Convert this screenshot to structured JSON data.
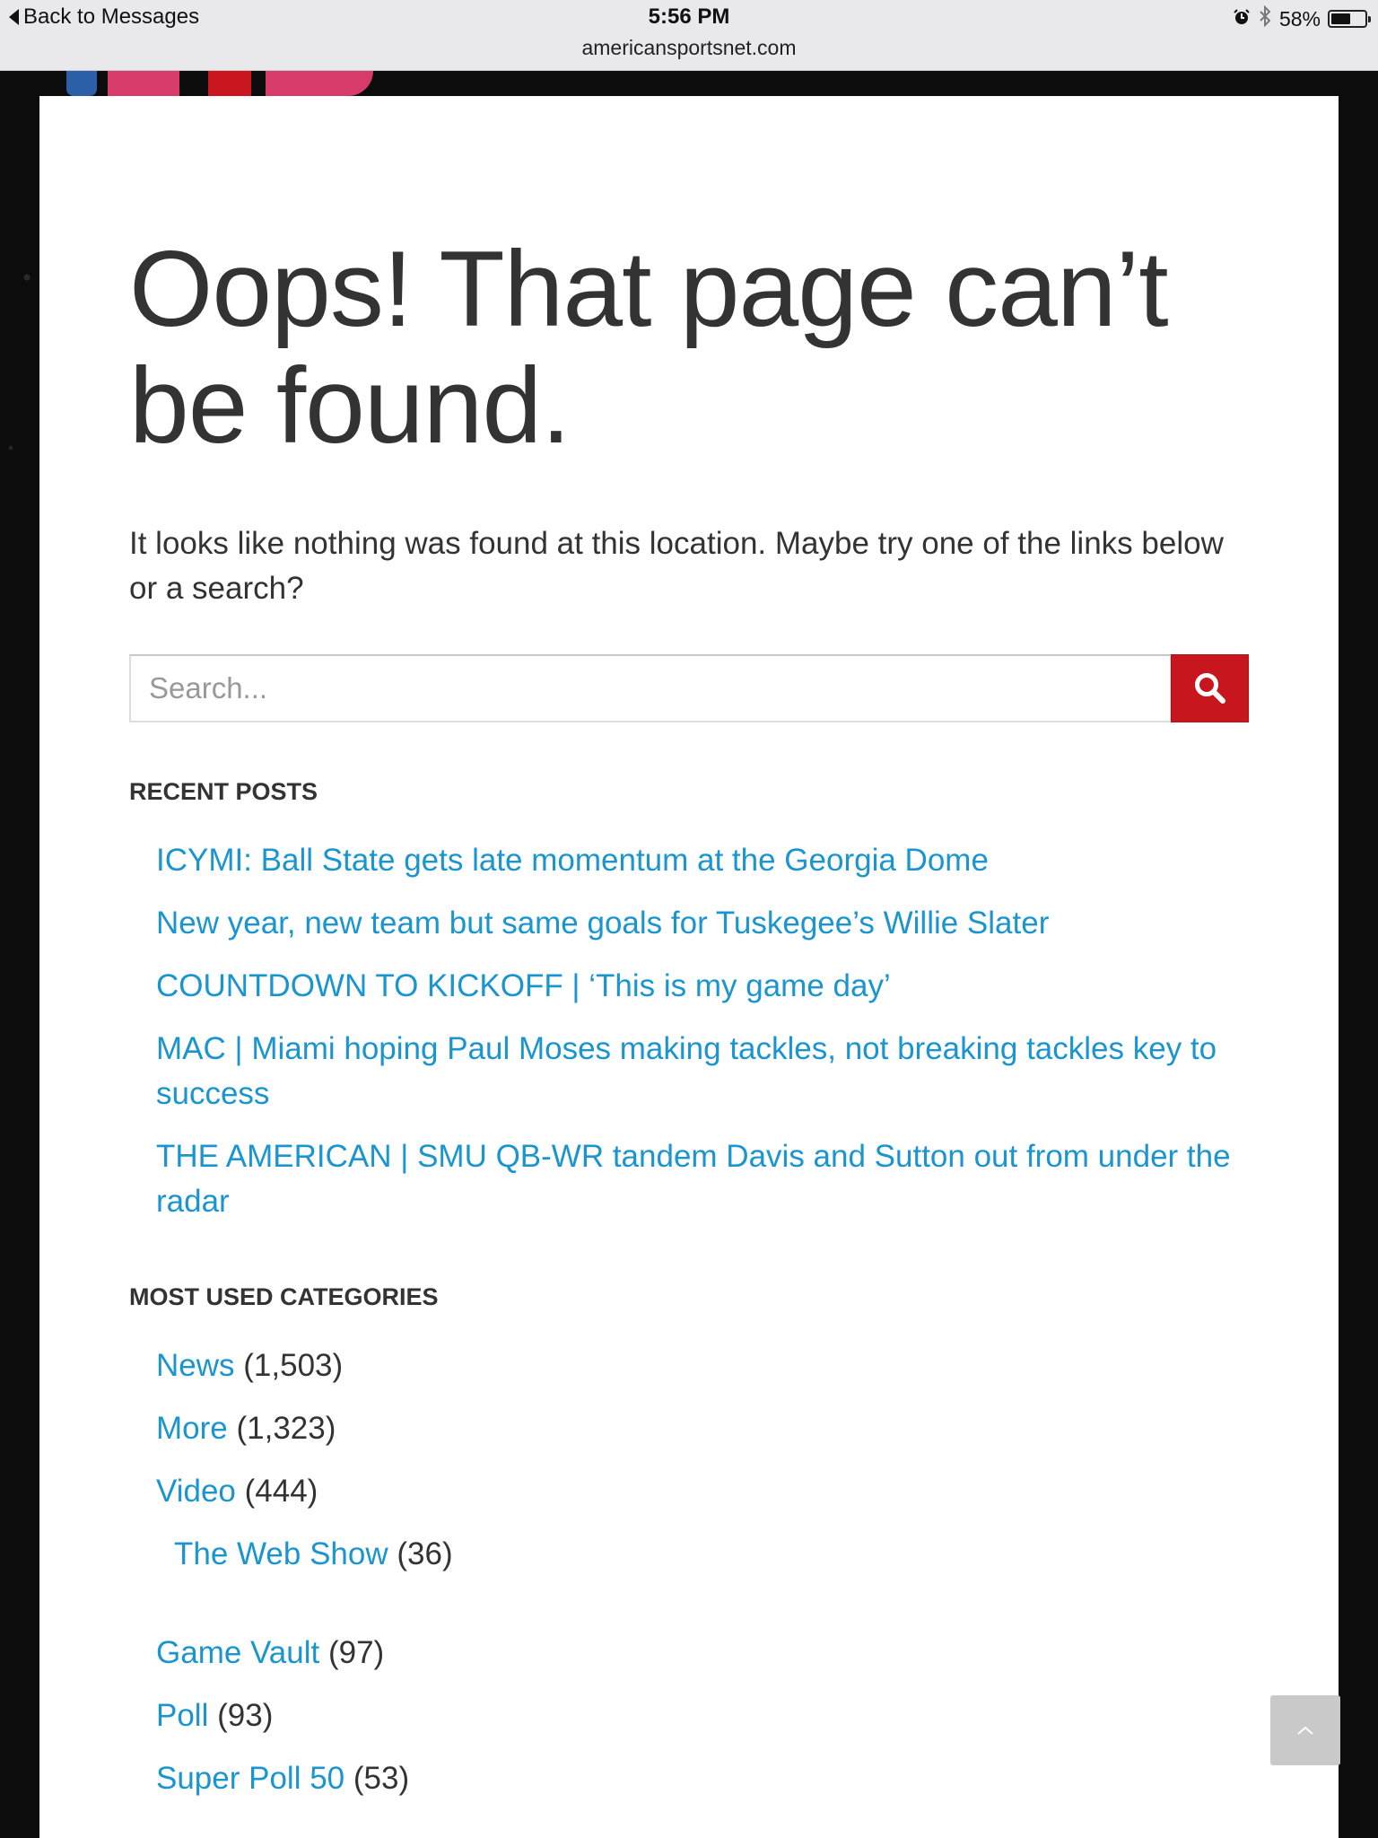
{
  "status_bar": {
    "back_label": "Back to Messages",
    "time": "5:56 PM",
    "url": "americansportsnet.com",
    "battery_percent": "58%",
    "battery_level": 0.58
  },
  "page": {
    "title": "Oops! That page can’t be found.",
    "intro": "It looks like nothing was found at this location. Maybe try one of the links below or a search?"
  },
  "search": {
    "placeholder": "Search...",
    "button_icon": "search-icon",
    "button_color": "#c8161e"
  },
  "recent_posts": {
    "heading": "RECENT POSTS",
    "items": [
      "ICYMI: Ball State gets late momentum at the Georgia Dome",
      "New year, new team but same goals for Tuskegee’s Willie Slater",
      "COUNTDOWN TO KICKOFF | ‘This is my game day’",
      "MAC | Miami hoping Paul Moses making tackles, not breaking tackles key to success",
      "THE AMERICAN | SMU QB-WR tandem Davis and Sutton out from under the radar"
    ]
  },
  "categories": {
    "heading": "MOST USED CATEGORIES",
    "items": [
      {
        "name": "News",
        "count": "(1,503)"
      },
      {
        "name": "More",
        "count": "(1,323)"
      },
      {
        "name": "Video",
        "count": "(444)"
      },
      {
        "name": "The Web Show",
        "count": "(36)"
      },
      {
        "name": "Game Vault",
        "count": "(97)"
      },
      {
        "name": "Poll",
        "count": "(93)"
      },
      {
        "name": "Super Poll 50",
        "count": "(53)"
      }
    ]
  },
  "colors": {
    "link": "#1a95cf",
    "text": "#333333",
    "accent": "#c8161e"
  },
  "scroll_top_icon": "chevron-up-icon"
}
